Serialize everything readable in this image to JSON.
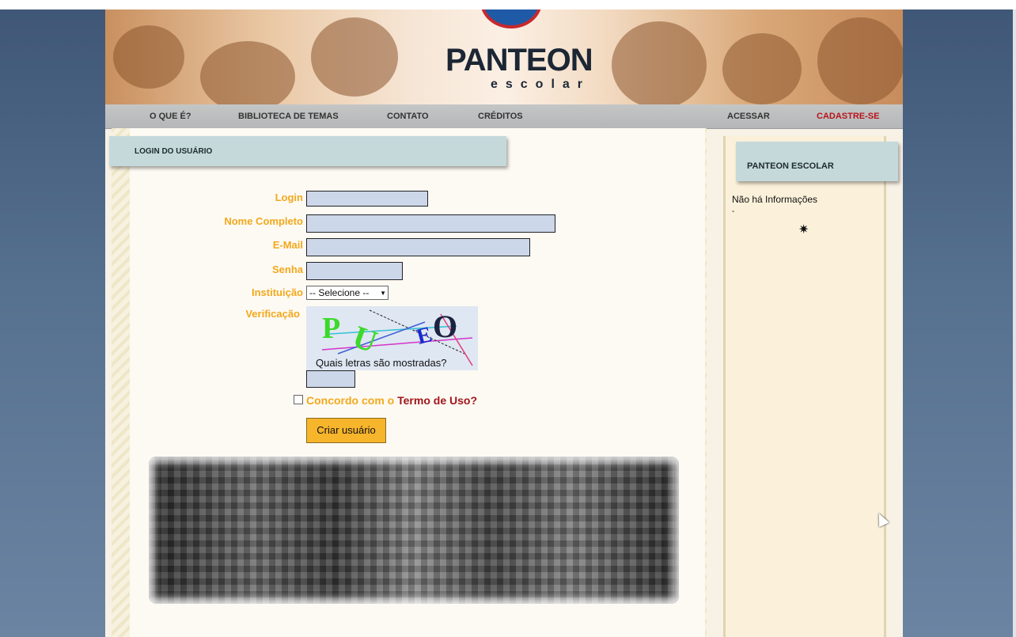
{
  "header": {
    "logo_title": "PANTEON",
    "logo_subtitle": "escolar"
  },
  "nav": {
    "items": [
      {
        "label": "O QUE É?"
      },
      {
        "label": "BIBLIOTECA DE TEMAS"
      },
      {
        "label": "CONTATO"
      },
      {
        "label": "CRÉDITOS"
      }
    ],
    "login": "ACESSAR",
    "register": "CADASTRE-SE"
  },
  "main": {
    "section_title": "LOGIN DO USUÁRIO",
    "form": {
      "login_label": "Login",
      "fullname_label": "Nome Completo",
      "email_label": "E-Mail",
      "password_label": "Senha",
      "institution_label": "Instituição",
      "institution_selected": "-- Selecione --",
      "verification_label": "Verificação",
      "captcha_question": "Quais letras são mostradas?",
      "captcha_letters": [
        "P",
        "U",
        "E",
        "O"
      ],
      "agree_text": "Concordo com o ",
      "terms_link": "Termo de Uso?",
      "submit_label": "Criar usuário"
    }
  },
  "sidebar": {
    "title": "PANTEON ESCOLAR",
    "info": "Não há Informações",
    "dash": "-"
  },
  "colors": {
    "label_orange": "#f2a81d",
    "link_red": "#a0151b",
    "nav_red": "#b8141b",
    "input_blue": "#ccd7ea",
    "button_orange": "#f7b52c",
    "tab_blue": "#c5d9db"
  }
}
